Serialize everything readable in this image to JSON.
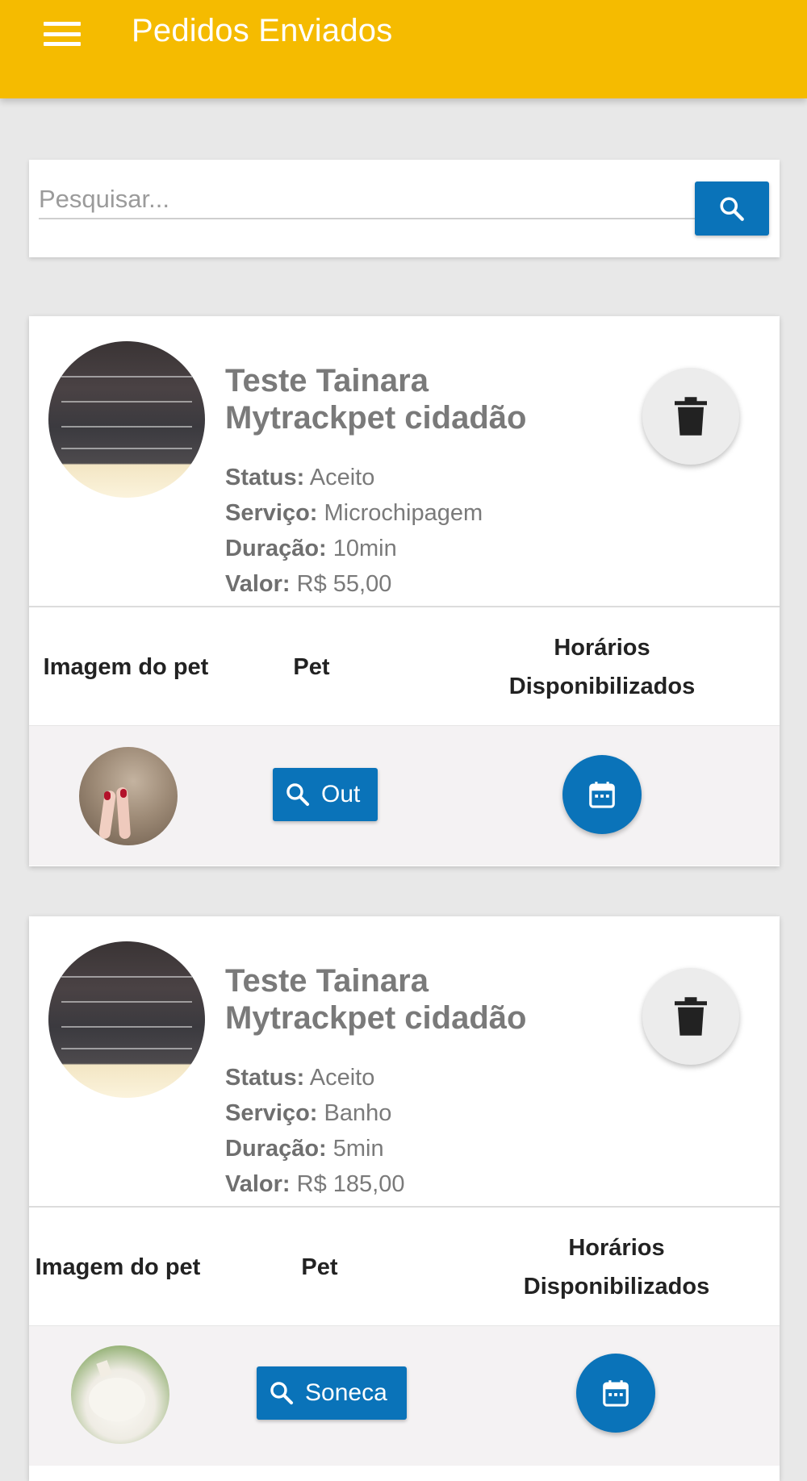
{
  "appbar": {
    "title": "Pedidos Enviados",
    "menu_icon": "menu-icon",
    "color": "#f5bb00"
  },
  "search": {
    "placeholder": "Pesquisar...",
    "value": "",
    "button_icon": "search-icon",
    "button_color": "#0a73b9"
  },
  "labels": {
    "status": "Status:",
    "servico": "Serviço:",
    "duracao": "Duração:",
    "valor": "Valor:"
  },
  "orders": [
    {
      "name": "Teste Tainara Mytrackpet cidadão",
      "status": "Aceito",
      "servico": "Microchipagem",
      "duracao": "10min",
      "valor": "R$ 55,00",
      "table": {
        "col_image": "Imagem do pet",
        "col_pet": "Pet",
        "col_horarios": "Horários Disponibilizados",
        "pet_name": "Out"
      }
    },
    {
      "name": "Teste Tainara Mytrackpet cidadão",
      "status": "Aceito",
      "servico": "Banho",
      "duracao": "5min",
      "valor": "R$ 185,00",
      "table": {
        "col_image": "Imagem do pet",
        "col_pet": "Pet",
        "col_horarios": "Horários Disponibilizados",
        "pet_name": "Soneca"
      }
    }
  ]
}
